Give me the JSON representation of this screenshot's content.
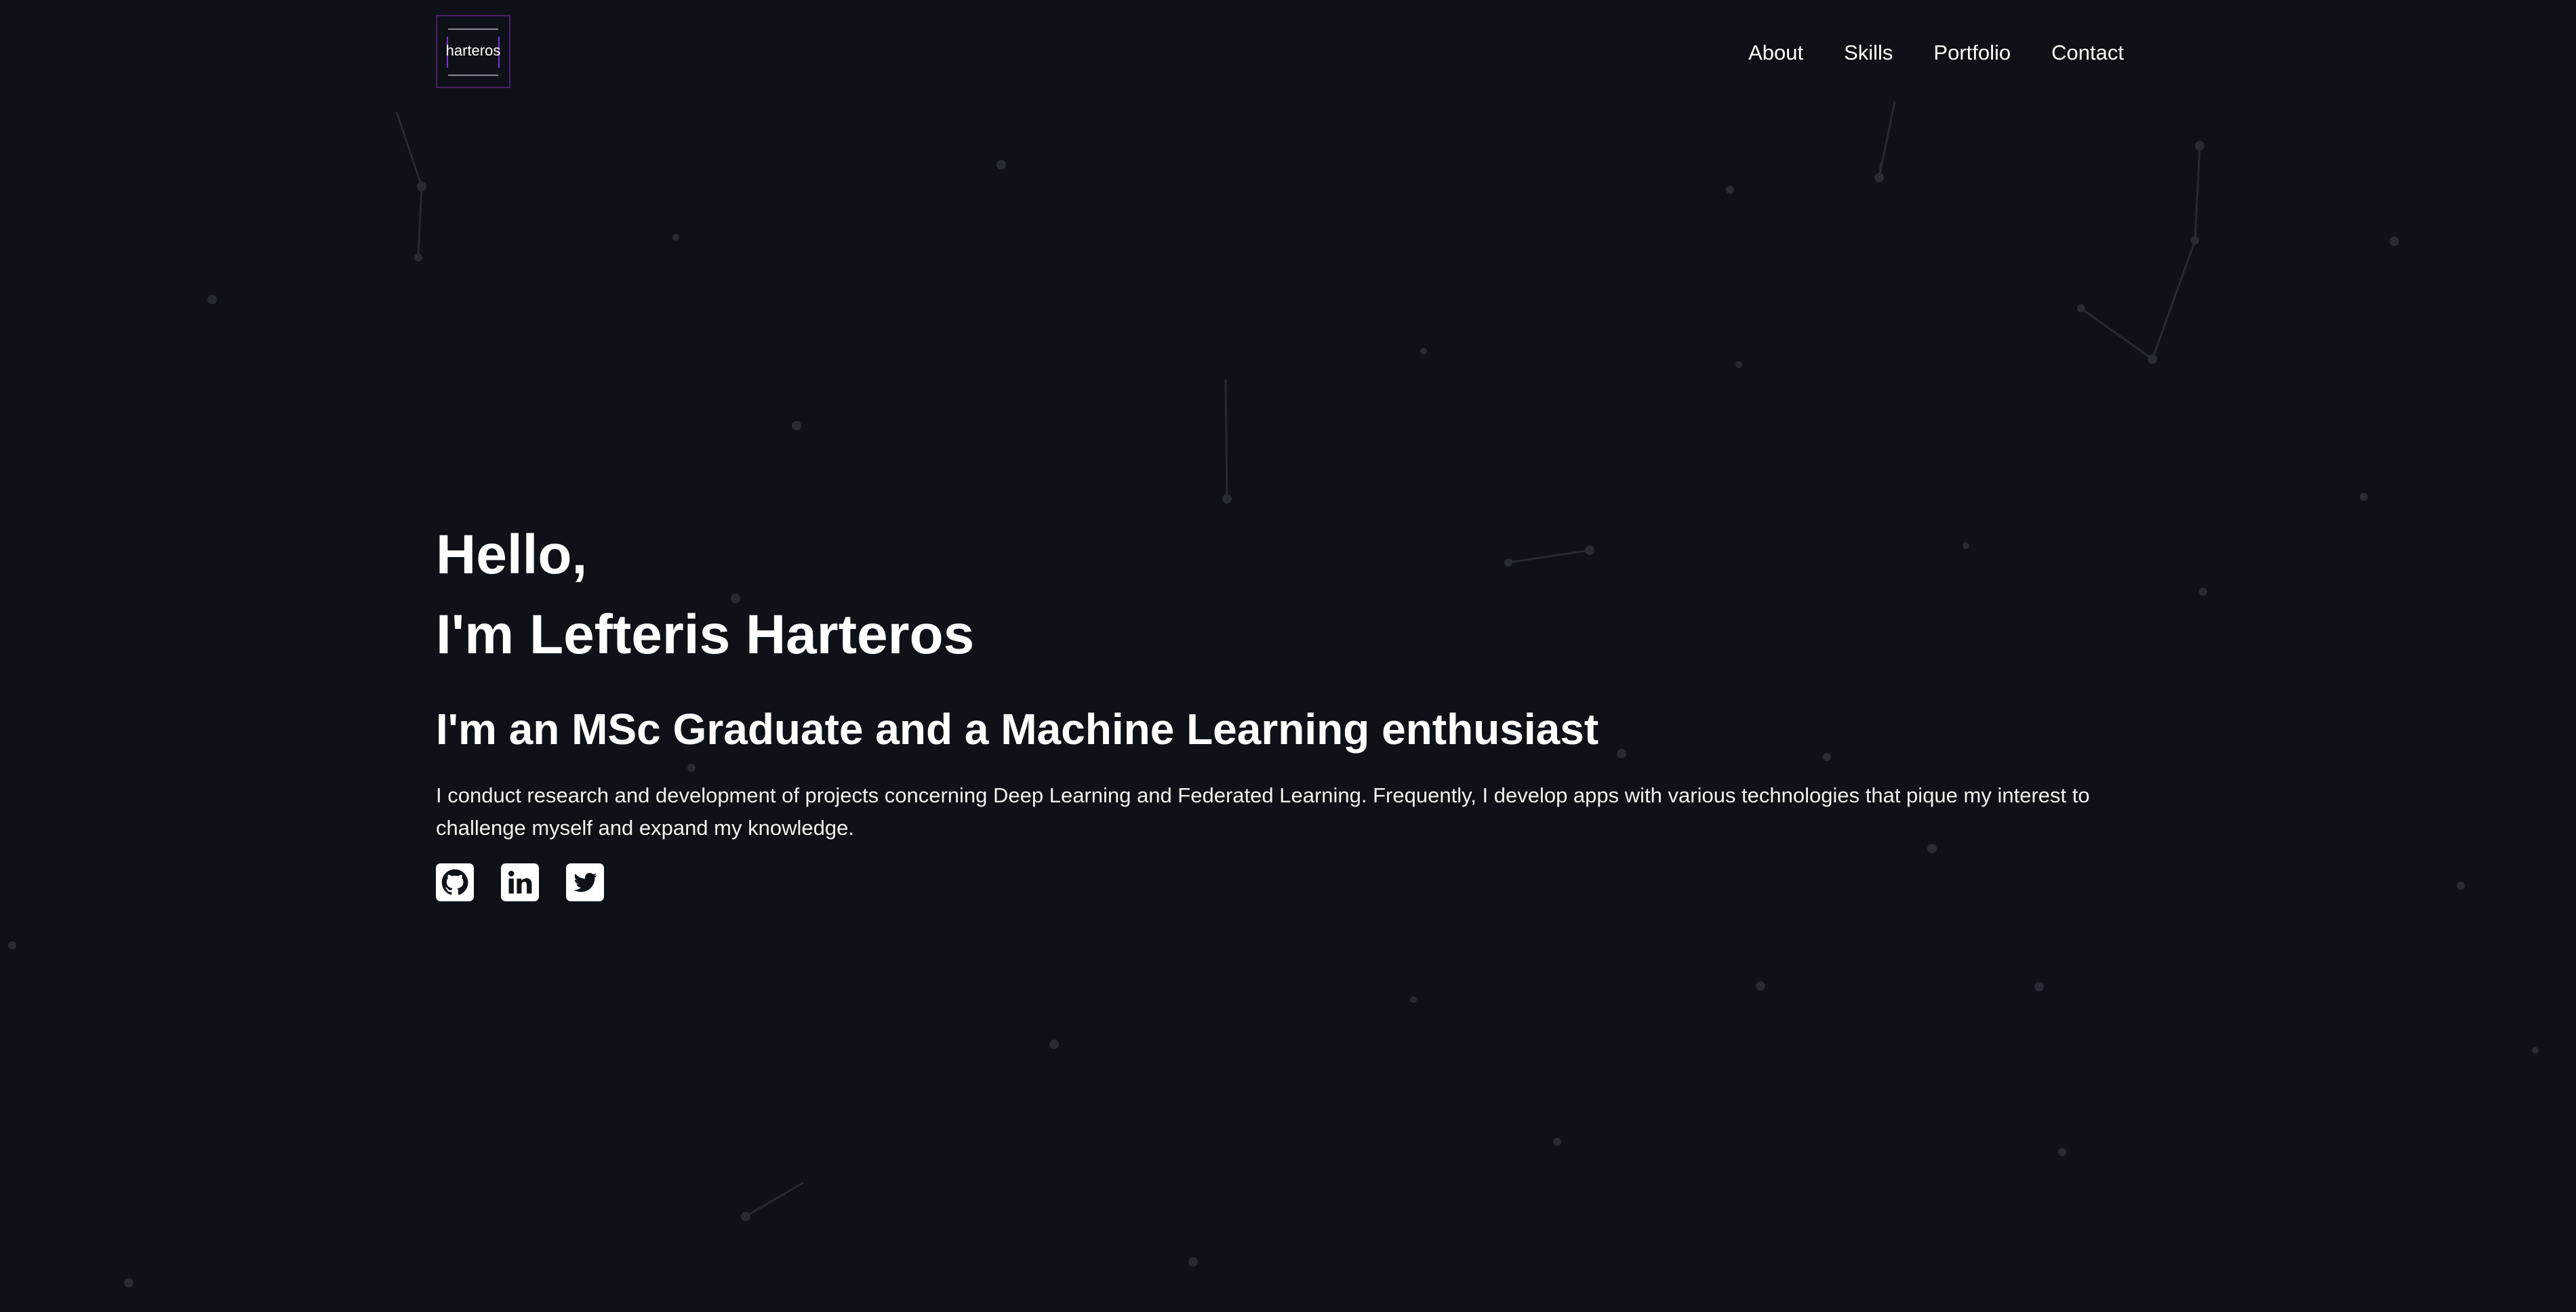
{
  "header": {
    "logo_text": "harteros",
    "nav": [
      {
        "label": "About"
      },
      {
        "label": "Skills"
      },
      {
        "label": "Portfolio"
      },
      {
        "label": "Contact"
      }
    ]
  },
  "hero": {
    "greeting": "Hello,",
    "name_line": "I'm Lefteris Harteros",
    "subtitle": "I'm an MSc Graduate and a Machine Learning enthusiast",
    "description": "I conduct research and development of projects concerning Deep Learning and Federated Learning. Frequently, I develop apps with various technologies that pique my interest to challenge myself and expand my knowledge.",
    "socials": [
      {
        "icon": "github-icon"
      },
      {
        "icon": "linkedin-icon"
      },
      {
        "icon": "twitter-icon"
      }
    ]
  },
  "colors": {
    "background": "#0e1117",
    "text": "#ffffff",
    "logo_accent": "#7a2fd0",
    "particles": "#2a2f3a"
  }
}
